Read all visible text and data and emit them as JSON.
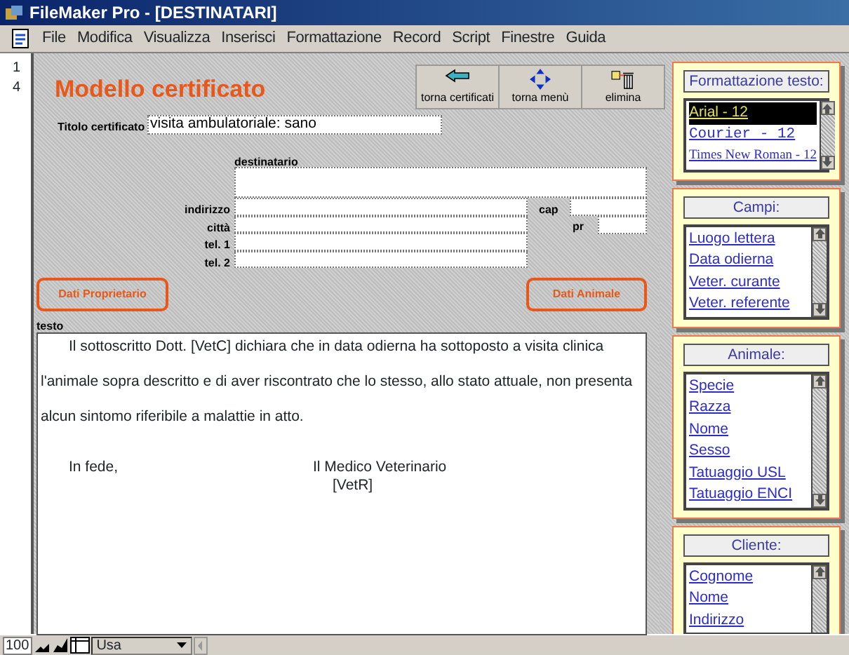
{
  "window": {
    "title": "FileMaker Pro - [DESTINATARI]"
  },
  "menu": [
    "File",
    "Modifica",
    "Visualizza",
    "Inserisci",
    "Formattazione",
    "Record",
    "Script",
    "Finestre",
    "Guida"
  ],
  "record_numbers": [
    "1",
    "4"
  ],
  "form": {
    "title": "Modello certificato",
    "toolbar_buttons": [
      {
        "label": "torna certificati",
        "kind": "back"
      },
      {
        "label": "torna menù",
        "kind": "move"
      },
      {
        "label": "elimina",
        "kind": "delete"
      }
    ],
    "certificate_title": {
      "label": "Titolo certificato",
      "value": "visita ambulatoriale: sano"
    },
    "recipient_label": "destinatario",
    "fields": [
      {
        "label": "indirizzo"
      },
      {
        "label": "città"
      },
      {
        "label": "tel. 1"
      },
      {
        "label": "tel. 2"
      }
    ],
    "side_fields": [
      {
        "label": "cap"
      },
      {
        "label": "pr"
      }
    ],
    "buttons": [
      "Dati Proprietario",
      "Dati Animale"
    ],
    "text_label": "testo",
    "text_lines": [
      {
        "text": "Il sottoscritto Dott. [VetC] dichiara che in data odierna ha sottoposto a visita clinica",
        "kind": "indent"
      },
      {
        "text": "l'animale sopra descritto e di aver riscontrato che lo stesso, allo stato attuale, non presenta",
        "kind": "plain"
      },
      {
        "text": "alcun sintomo riferibile a malattie in atto.",
        "kind": "plain"
      }
    ],
    "signature": {
      "left": "In fede,",
      "right": "Il Medico Veterinario",
      "name": "[VetR]"
    }
  },
  "panels": [
    {
      "title": "Formattazione testo:",
      "items": [
        {
          "label": "Arial - 12",
          "kind": "sans",
          "selected": true
        },
        {
          "label": "Courier - 12",
          "kind": "mono",
          "selected": false
        },
        {
          "label": "Times New Roman - 12",
          "kind": "serif",
          "selected": false
        }
      ]
    },
    {
      "title": "Campi:",
      "items": [
        {
          "label": "Luogo lettera",
          "kind": "sans",
          "selected": false
        },
        {
          "label": "Data odierna",
          "kind": "sans",
          "selected": false
        },
        {
          "label": "Veter. curante",
          "kind": "sans",
          "selected": false
        },
        {
          "label": "Veter. referente",
          "kind": "sans",
          "selected": false
        }
      ]
    },
    {
      "title": "Animale:",
      "items": [
        {
          "label": "Specie",
          "kind": "sans",
          "selected": false
        },
        {
          "label": "Razza",
          "kind": "sans",
          "selected": false
        },
        {
          "label": "Nome",
          "kind": "sans",
          "selected": false
        },
        {
          "label": "Sesso",
          "kind": "sans",
          "selected": false
        },
        {
          "label": "Tatuaggio USL",
          "kind": "sans",
          "selected": false
        },
        {
          "label": "Tatuaggio ENCI",
          "kind": "sans",
          "selected": false
        }
      ]
    },
    {
      "title": "Cliente:",
      "items": [
        {
          "label": "Cognome",
          "kind": "sans",
          "selected": false
        },
        {
          "label": "Nome",
          "kind": "sans",
          "selected": false
        },
        {
          "label": "Indirizzo",
          "kind": "sans",
          "selected": false
        }
      ]
    }
  ],
  "status_bar": {
    "zoom": "100",
    "mode": "Usa"
  }
}
